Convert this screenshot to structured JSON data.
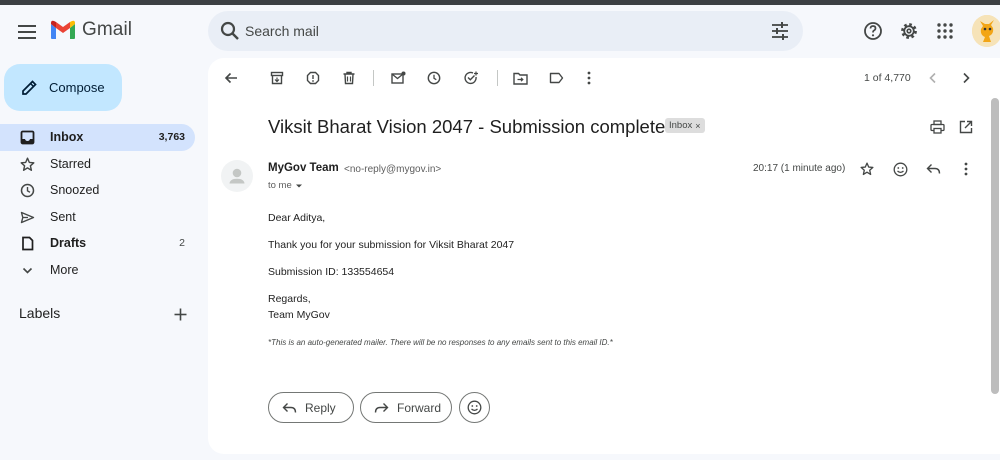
{
  "app": {
    "name": "Gmail"
  },
  "search": {
    "placeholder": "Search mail"
  },
  "header": {
    "right_icons": [
      "help-icon",
      "settings-icon",
      "apps-icon"
    ]
  },
  "sidebar": {
    "compose_label": "Compose",
    "items": [
      {
        "label": "Inbox",
        "count": "3,763",
        "icon": "inbox-icon",
        "active": true
      },
      {
        "label": "Starred",
        "count": "",
        "icon": "star-icon"
      },
      {
        "label": "Snoozed",
        "count": "",
        "icon": "clock-icon"
      },
      {
        "label": "Sent",
        "count": "",
        "icon": "send-icon"
      },
      {
        "label": "Drafts",
        "count": "2",
        "icon": "draft-icon"
      },
      {
        "label": "More",
        "count": "",
        "icon": "chevron-down-icon"
      }
    ],
    "labels_heading": "Labels"
  },
  "toolbar": {
    "pager": "1 of 4,770"
  },
  "message": {
    "subject": "Viksit Bharat Vision 2047 - Submission complete",
    "label_chip": "Inbox",
    "sender_name": "MyGov Team",
    "sender_email": "<no-reply@mygov.in>",
    "recipient": "to me",
    "timestamp": "20:17 (1 minute ago)",
    "body": {
      "greeting": "Dear Aditya,",
      "line1": "Thank you for your submission for Viksit Bharat 2047",
      "line2": "Submission ID: 133554654",
      "closing1": "Regards,",
      "closing2": "Team MyGov",
      "footnote": "*This is an auto-generated mailer. There will be no responses to any emails sent to this email ID.*"
    }
  },
  "actions": {
    "reply_label": "Reply",
    "forward_label": "Forward"
  },
  "colors": {
    "compose_bg": "#c2e7ff",
    "active_nav_bg": "#d3e3fd",
    "search_bg": "#e9eef6",
    "page_bg": "#f6f8fc"
  }
}
